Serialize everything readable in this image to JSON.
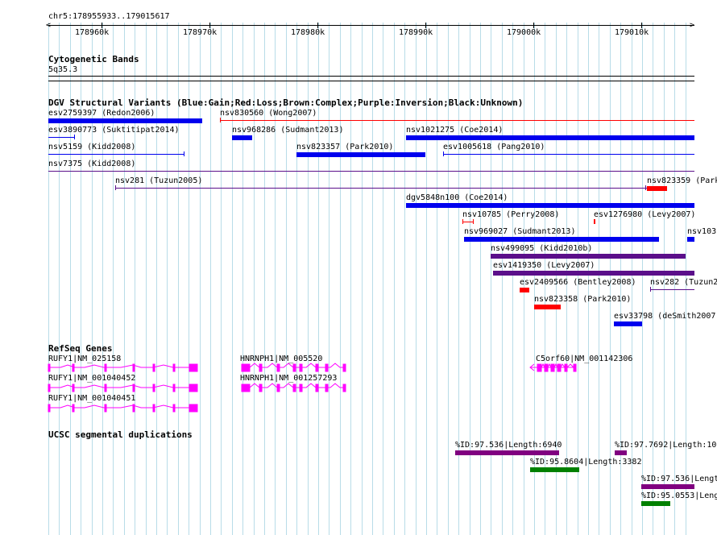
{
  "ruler": {
    "location": "chr5:178955933..179015617",
    "ticks": [
      "178960k",
      "178970k",
      "178980k",
      "178990k",
      "179000k",
      "179010k"
    ]
  },
  "tracks": {
    "cytobands": {
      "title": "Cytogenetic Bands",
      "band": "5q35.3"
    },
    "dgv": {
      "title": "DGV Structural Variants (Blue:Gain;Red:Loss;Brown:Complex;Purple:Inversion;Black:Unknown)",
      "labels": [
        "esv2759397 (Redon2006)",
        "nsv830560 (Wong2007)",
        "esv3890773 (Suktitipat2014)",
        "nsv968286 (Sudmant2013)",
        "nsv1021275 (Coe2014)",
        "nsv5159 (Kidd2008)",
        "nsv823357 (Park2010)",
        "esv1005618 (Pang2010)",
        "nsv7375 (Kidd2008)",
        "nsv281 (Tuzun2005)",
        "nsv823359 (Park",
        "dgv5848n100 (Coe2014)",
        "nsv10785 (Perry2008)",
        "esv1276980 (Levy2007)",
        "nsv969027 (Sudmant2013)",
        "nsv1031",
        "nsv499095 (Kidd2010b)",
        "esv1419350 (Levy2007)",
        "esv2409566 (Bentley2008)",
        "nsv282 (Tuzun2",
        "nsv823358 (Park2010)",
        "esv33798 (deSmith2007"
      ]
    },
    "refseq": {
      "title": "RefSeq Genes",
      "labels": [
        "RUFY1|NM_025158",
        "RUFY1|NM_001040452",
        "RUFY1|NM_001040451",
        "HNRNPH1|NM_005520",
        "HNRNPH1|NM_001257293",
        "C5orf60|NM_001142306"
      ]
    },
    "segdup": {
      "title": "UCSC segmental duplications",
      "labels": [
        "%ID:97.536|Length:6940",
        "%ID:97.7692|Length:103",
        "%ID:95.8604|Length:3382",
        "%ID:97.536|Lengt",
        "%ID:95.0553|Leng"
      ]
    }
  },
  "colors": {
    "gain": "#0000ee",
    "loss": "#ff0000",
    "complex": "#8b4513",
    "inversion": "#5b0f8a",
    "unknown": "#000000",
    "gene": "#ff00ff",
    "segdup_purple": "#800080",
    "segdup_green": "#008000",
    "grid": "#b8dce8"
  }
}
